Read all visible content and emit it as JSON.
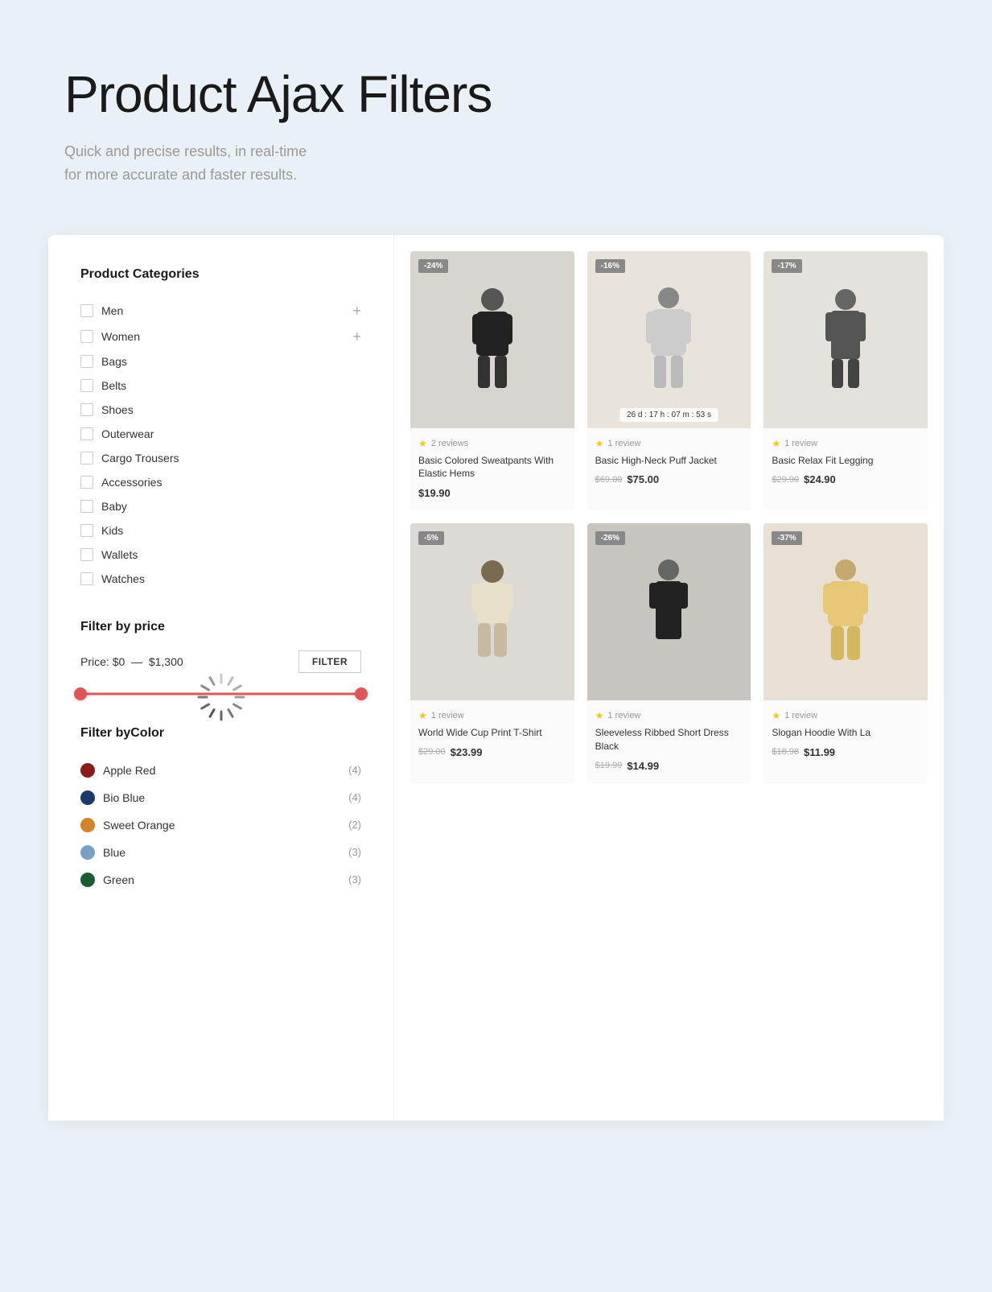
{
  "hero": {
    "title": "Product Ajax Filters",
    "subtitle_line1": "Quick and precise results, in real-time",
    "subtitle_line2": "for more accurate and faster results."
  },
  "sidebar": {
    "categories_title": "Product Categories",
    "categories": [
      {
        "label": "Men",
        "expandable": true
      },
      {
        "label": "Women",
        "expandable": true
      },
      {
        "label": "Bags",
        "expandable": false
      },
      {
        "label": "Belts",
        "expandable": false
      },
      {
        "label": "Shoes",
        "expandable": false
      },
      {
        "label": "Outerwear",
        "expandable": false
      },
      {
        "label": "Cargo Trousers",
        "expandable": false
      },
      {
        "label": "Accessories",
        "expandable": false
      },
      {
        "label": "Baby",
        "expandable": false
      },
      {
        "label": "Kids",
        "expandable": false
      },
      {
        "label": "Wallets",
        "expandable": false
      },
      {
        "label": "Watches",
        "expandable": false
      }
    ],
    "filter_price_title": "Filter by price",
    "price_label": "Price:",
    "price_min": "$0",
    "price_separator": "—",
    "price_max": "$1,300",
    "filter_button": "FILTER",
    "filter_color_title": "Filter byColor",
    "colors": [
      {
        "label": "Apple Red",
        "count": "(4)",
        "hex": "#8b1a1a"
      },
      {
        "label": "Bio Blue",
        "count": "(4)",
        "hex": "#1a3a6b"
      },
      {
        "label": "Sweet Orange",
        "count": "(2)",
        "hex": "#d4832a"
      },
      {
        "label": "Blue",
        "count": "(3)",
        "hex": "#7a9ec4"
      },
      {
        "label": "Green",
        "count": "(3)",
        "hex": "#1a5c35"
      }
    ]
  },
  "products": [
    {
      "badge": "-24%",
      "reviews": "2 reviews",
      "name": "Basic Colored Sweatpants With Elastic Hems",
      "price_old": "",
      "price_new": "$19.90",
      "bg": "dark",
      "countdown": "",
      "has_countdown": false
    },
    {
      "badge": "-16%",
      "reviews": "1 review",
      "name": "Basic High-Neck Puff Jacket",
      "price_old": "$69.00",
      "price_new": "$75.00",
      "bg": "cream",
      "countdown": "26 d : 17 h : 07 m : 53 s",
      "has_countdown": true
    },
    {
      "badge": "-17%",
      "reviews": "1 review",
      "name": "Basic Relax Fit Legging",
      "price_old": "$29.90",
      "price_new": "$24.90",
      "bg": "light-gray",
      "countdown": "",
      "has_countdown": false
    },
    {
      "badge": "-5%",
      "reviews": "1 review",
      "name": "World Wide Cup Print T-Shirt",
      "price_old": "$29.00",
      "price_new": "$23.99",
      "bg": "mid",
      "countdown": "",
      "has_countdown": false
    },
    {
      "badge": "-26%",
      "reviews": "1 review",
      "name": "Sleeveless Ribbed Short Dress Black",
      "price_old": "$19.99",
      "price_new": "$14.99",
      "bg": "dark-item",
      "countdown": "",
      "has_countdown": false
    },
    {
      "badge": "-37%",
      "reviews": "1 review",
      "name": "Slogan Hoodie With La",
      "price_old": "$18.98",
      "price_new": "$11.99",
      "bg": "beige",
      "countdown": "",
      "has_countdown": false
    }
  ]
}
